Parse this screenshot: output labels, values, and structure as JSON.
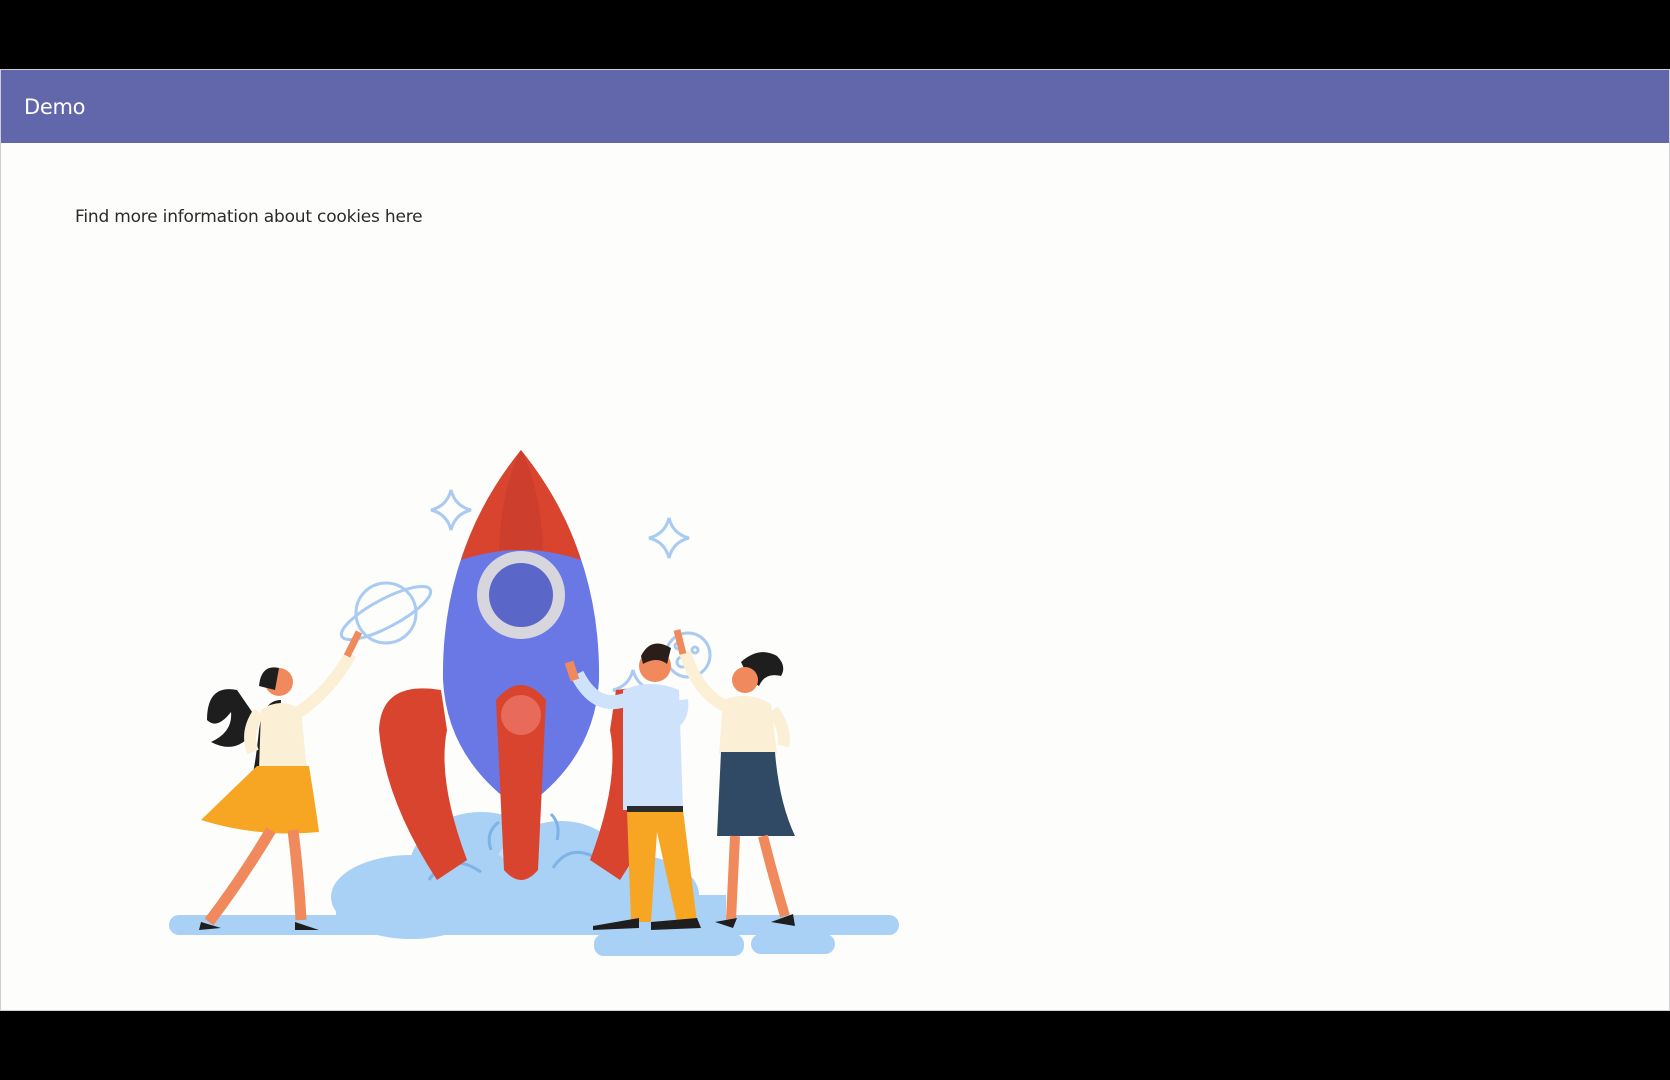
{
  "header": {
    "title": "Demo"
  },
  "main": {
    "cookie_link_text": "Find more information about cookies here",
    "illustration": {
      "icon": "rocket-launch-illustration"
    }
  },
  "colors": {
    "header_bg": "#6266aa",
    "page_bg": "#fdfdfb",
    "rocket_body": "#6a78e6",
    "rocket_fins": "#d9442f",
    "cloud": "#a9d0f5"
  }
}
